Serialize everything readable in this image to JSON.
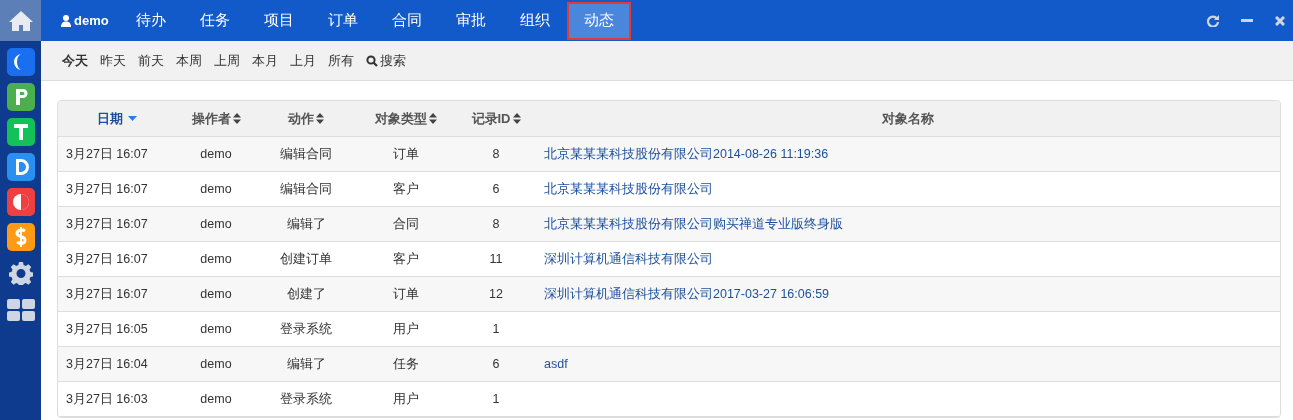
{
  "sidebar": {
    "apps": [
      {
        "kind": "c",
        "color": "#1a6ff0"
      },
      {
        "kind": "p",
        "color": "#4cae4c"
      },
      {
        "kind": "t",
        "color": "#12c157"
      },
      {
        "kind": "d",
        "color": "#2a8ff0"
      },
      {
        "kind": "o",
        "color": "#ee4040"
      },
      {
        "kind": "s",
        "color": "#ff9a16"
      }
    ]
  },
  "navbar": {
    "user": "demo",
    "tabs": [
      {
        "label": "待办",
        "selected": false
      },
      {
        "label": "任务",
        "selected": false
      },
      {
        "label": "项目",
        "selected": false
      },
      {
        "label": "订单",
        "selected": false
      },
      {
        "label": "合同",
        "selected": false
      },
      {
        "label": "审批",
        "selected": false
      },
      {
        "label": "组织",
        "selected": false
      },
      {
        "label": "动态",
        "selected": true
      }
    ]
  },
  "filters": [
    {
      "label": "今天",
      "selected": true
    },
    {
      "label": "昨天",
      "selected": false
    },
    {
      "label": "前天",
      "selected": false
    },
    {
      "label": "本周",
      "selected": false
    },
    {
      "label": "上周",
      "selected": false
    },
    {
      "label": "本月",
      "selected": false
    },
    {
      "label": "上月",
      "selected": false
    },
    {
      "label": "所有",
      "selected": false
    },
    {
      "label": "搜索",
      "selected": false,
      "kind": "search"
    }
  ],
  "table": {
    "columns": [
      {
        "label": "日期",
        "sorted": true
      },
      {
        "label": "操作者",
        "sorted": false
      },
      {
        "label": "动作",
        "sorted": false
      },
      {
        "label": "对象类型",
        "sorted": false
      },
      {
        "label": "记录ID",
        "sorted": false
      },
      {
        "label": "对象名称"
      }
    ],
    "rows": [
      [
        "3月27日 16:07",
        "demo",
        "编辑合同",
        "订单",
        "8",
        "北京某某某科技股份有限公司2014-08-26 11:19:36"
      ],
      [
        "3月27日 16:07",
        "demo",
        "编辑合同",
        "客户",
        "6",
        "北京某某某科技股份有限公司"
      ],
      [
        "3月27日 16:07",
        "demo",
        "编辑了",
        "合同",
        "8",
        "北京某某某科技股份有限公司购买禅道专业版终身版"
      ],
      [
        "3月27日 16:07",
        "demo",
        "创建订单",
        "客户",
        "11",
        "深圳计算机通信科技有限公司"
      ],
      [
        "3月27日 16:07",
        "demo",
        "创建了",
        "订单",
        "12",
        "深圳计算机通信科技有限公司2017-03-27 16:06:59"
      ],
      [
        "3月27日 16:05",
        "demo",
        "登录系统",
        "用户",
        "1",
        ""
      ],
      [
        "3月27日 16:04",
        "demo",
        "编辑了",
        "任务",
        "6",
        "asdf"
      ],
      [
        "3月27日 16:03",
        "demo",
        "登录系统",
        "用户",
        "1",
        ""
      ]
    ]
  }
}
